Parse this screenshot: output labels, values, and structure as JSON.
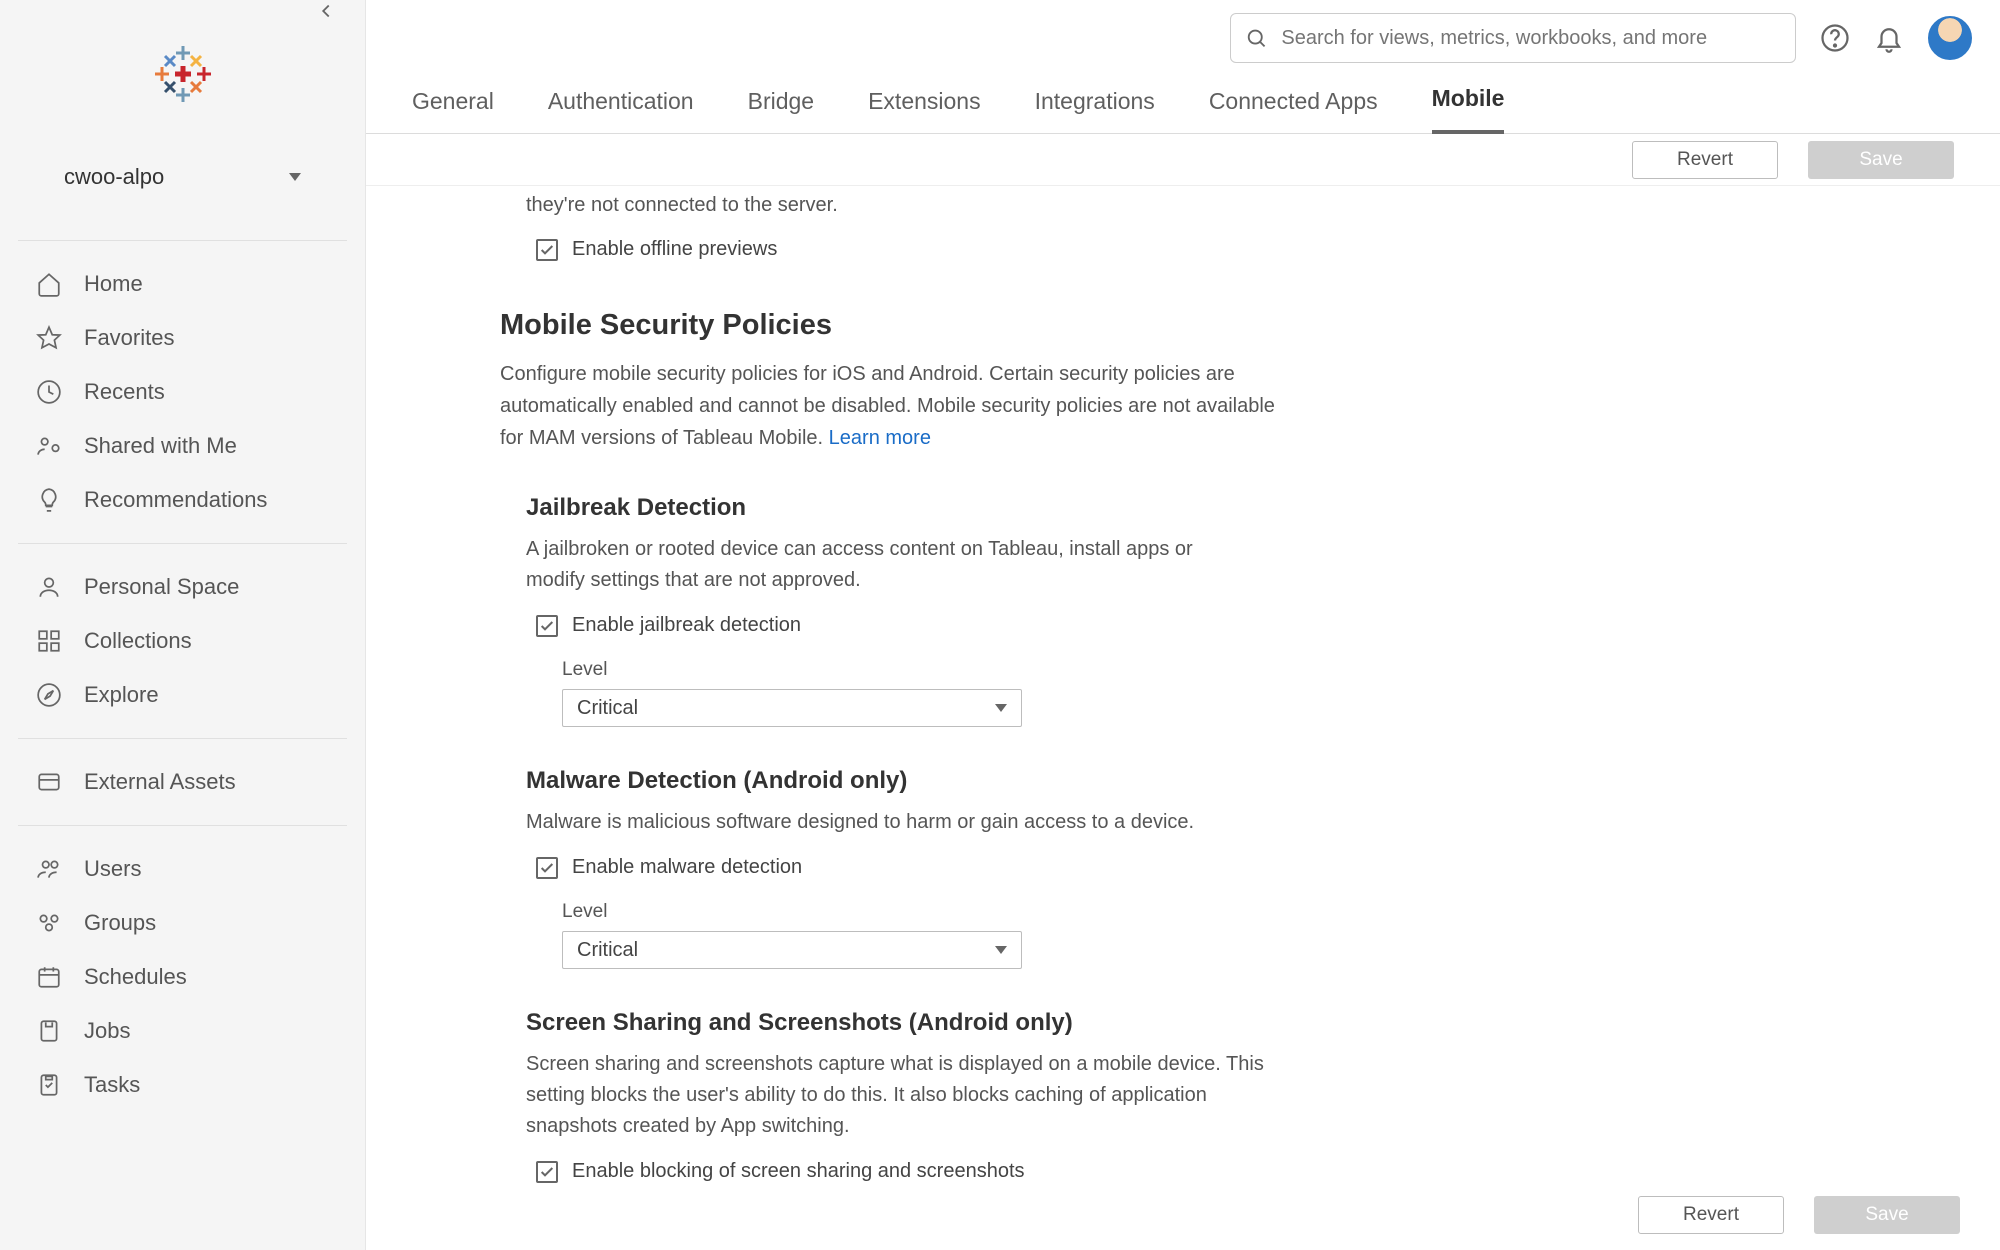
{
  "site_name": "cwoo-alpo",
  "search": {
    "placeholder": "Search for views, metrics, workbooks, and more"
  },
  "sidebar": {
    "group1": [
      {
        "label": "Home"
      },
      {
        "label": "Favorites"
      },
      {
        "label": "Recents"
      },
      {
        "label": "Shared with Me"
      },
      {
        "label": "Recommendations"
      }
    ],
    "group2": [
      {
        "label": "Personal Space"
      },
      {
        "label": "Collections"
      },
      {
        "label": "Explore"
      }
    ],
    "group3": [
      {
        "label": "External Assets"
      }
    ],
    "group4": [
      {
        "label": "Users"
      },
      {
        "label": "Groups"
      },
      {
        "label": "Schedules"
      },
      {
        "label": "Jobs"
      },
      {
        "label": "Tasks"
      }
    ]
  },
  "tabs": [
    "General",
    "Authentication",
    "Bridge",
    "Extensions",
    "Integrations",
    "Connected Apps",
    "Mobile"
  ],
  "active_tab": "Mobile",
  "buttons": {
    "revert": "Revert",
    "save": "Save"
  },
  "offline": {
    "partial_desc": "they're not connected to the server.",
    "checkbox_label": "Enable offline previews"
  },
  "policies": {
    "title": "Mobile Security Policies",
    "desc": "Configure mobile security policies for iOS and Android. Certain security policies are automatically enabled and cannot be disabled. Mobile security policies are not available for MAM versions of Tableau Mobile.  ",
    "learn_more": "Learn more"
  },
  "jailbreak": {
    "title": "Jailbreak Detection",
    "desc": "A jailbroken or rooted device can access content on Tableau, install apps or modify settings that are not approved.",
    "checkbox_label": "Enable jailbreak detection",
    "level_label": "Level",
    "level_value": "Critical"
  },
  "malware": {
    "title": "Malware Detection (Android only)",
    "desc": "Malware is malicious software designed to harm or gain access to a device.",
    "checkbox_label": "Enable malware detection",
    "level_label": "Level",
    "level_value": "Critical"
  },
  "screenshare": {
    "title": "Screen Sharing and Screenshots (Android only)",
    "desc": "Screen sharing and screenshots capture what is displayed on a mobile device. This setting blocks the user's ability to do this. It also blocks caching of application snapshots created by App switching.",
    "checkbox_label": "Enable blocking of screen sharing and screenshots"
  }
}
